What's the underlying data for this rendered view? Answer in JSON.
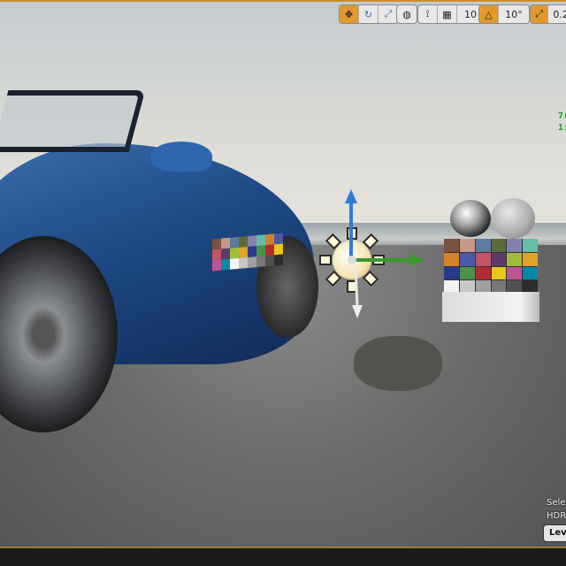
{
  "viewport": {
    "toolbar": {
      "transform_tools": [
        {
          "icon": "translate-icon",
          "active": true
        },
        {
          "icon": "rotate-icon",
          "active": false
        },
        {
          "icon": "scale-icon",
          "active": false
        }
      ],
      "world_local_icon": "globe-icon",
      "surface_snap_icon": "surface-snap-icon",
      "grid_icon": "grid-icon",
      "grid_snap_value": "10",
      "rotation_snap_icon": "angle-icon",
      "rotation_snap_value": "10°",
      "scale_snap_icon": "scale-snap-icon",
      "scale_snap_value": "0.2"
    },
    "stats": {
      "line1": "7(",
      "line2": "1:"
    },
    "info": {
      "line1": "Sele",
      "line2": "HDR"
    },
    "level_button": "Leve",
    "accent_color": "#e39a2c",
    "stat_color": "#1f9a2a"
  }
}
